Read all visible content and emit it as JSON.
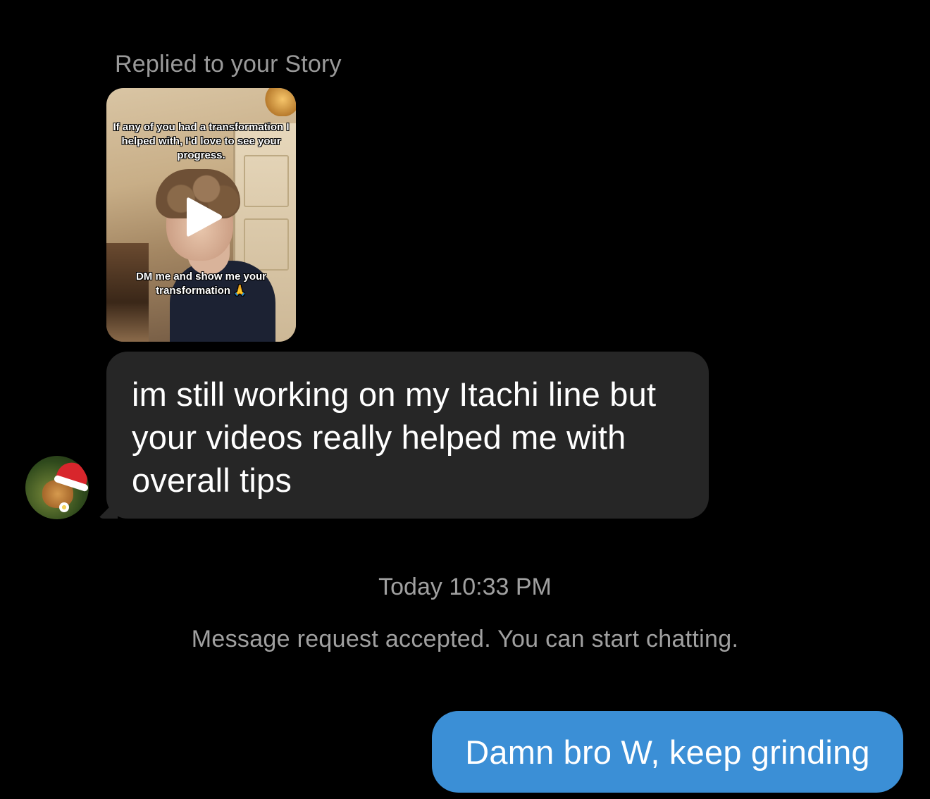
{
  "conversation": {
    "story_reply": {
      "label": "Replied to your Story",
      "caption_top": "If any of you had a transformation I helped with, I'd love to see your progress.",
      "caption_bottom": "DM me and show me your transformation 🙏",
      "media_type": "video",
      "play_icon": "play-icon"
    },
    "received_message": {
      "text": "im still working on my Itachi line but your videos really helped me with overall tips",
      "avatar_icon": "user-avatar"
    },
    "timestamp": "Today 10:33 PM",
    "system_message": "Message request accepted. You can start chatting.",
    "sent_message": {
      "text": "Damn bro W, keep grinding"
    }
  },
  "colors": {
    "background": "#000000",
    "received_bubble": "#262626",
    "sent_bubble": "#3b8fd6",
    "meta_text": "#a0a0a0"
  }
}
